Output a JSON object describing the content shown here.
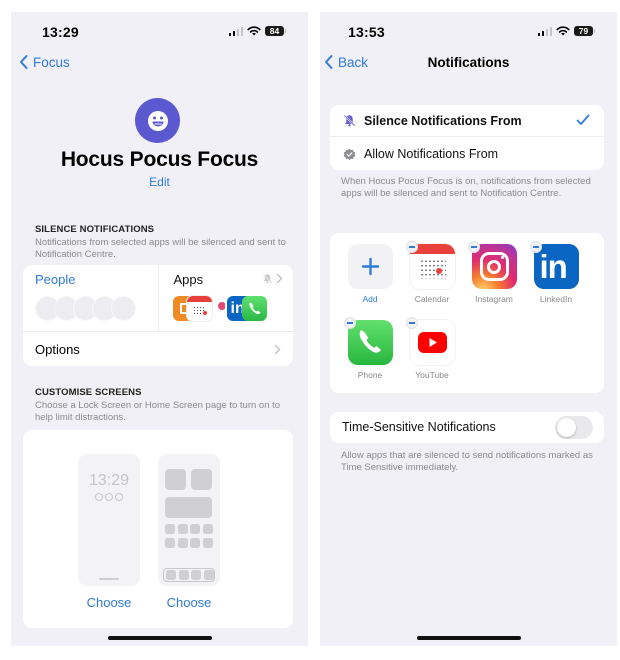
{
  "left": {
    "status": {
      "time": "13:29",
      "battery": "84"
    },
    "nav": {
      "back_label": "Focus"
    },
    "focus": {
      "name": "Hocus Pocus Focus",
      "edit_label": "Edit",
      "icon": "smiley-face-icon",
      "color": "#5b59d0"
    },
    "silence_section": {
      "header": "SILENCE NOTIFICATIONS",
      "footer": "Notifications from selected apps will be silenced and sent to Notification Centre.",
      "people_label": "People",
      "apps_label": "Apps",
      "app_icons": [
        "books",
        "calendar",
        "instagram",
        "linkedin",
        "phone"
      ],
      "options_label": "Options"
    },
    "screens_section": {
      "header": "CUSTOMISE SCREENS",
      "footer": "Choose a Lock Screen or Home Screen page to turn on to help limit distractions.",
      "lock_screen_time": "13:29",
      "lock_choose_label": "Choose",
      "home_choose_label": "Choose"
    }
  },
  "right": {
    "status": {
      "time": "13:53",
      "battery": "79"
    },
    "nav": {
      "back_label": "Back",
      "title": "Notifications"
    },
    "modes": [
      {
        "label": "Silence Notifications From",
        "icon": "bell-slash-icon",
        "selected": true
      },
      {
        "label": "Allow Notifications From",
        "icon": "checkmark-seal-icon",
        "selected": false
      }
    ],
    "modes_footer": "When Hocus Pocus Focus is on, notifications from selected apps will be silenced and sent to Notification Centre.",
    "apps": [
      {
        "name": "Add"
      },
      {
        "name": "Calendar"
      },
      {
        "name": "Instagram"
      },
      {
        "name": "LinkedIn"
      },
      {
        "name": "Phone"
      },
      {
        "name": "YouTube"
      }
    ],
    "time_sensitive": {
      "label": "Time-Sensitive Notifications",
      "enabled": false,
      "footer": "Allow apps that are silenced to send notifications marked as Time Sensitive immediately."
    }
  },
  "colors": {
    "accent": "#2f7bd9",
    "background": "#f1f0f6",
    "focus_purple": "#5b59d0"
  }
}
